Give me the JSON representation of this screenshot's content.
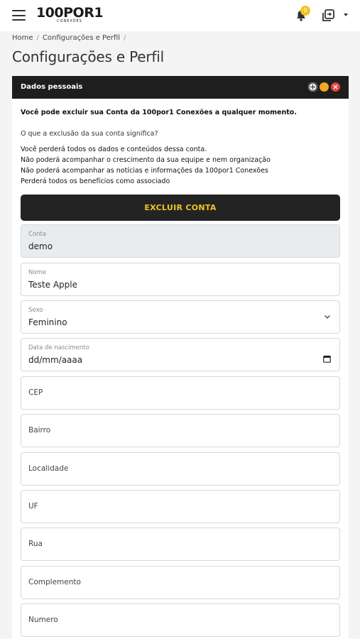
{
  "header": {
    "logo_main": "100POR1",
    "logo_sub": "CONEXÕES",
    "notification_count": "0"
  },
  "breadcrumb": {
    "items": [
      "Home",
      "Configurações e Perfil"
    ]
  },
  "page_title": "Configurações e Perfil",
  "panel": {
    "title": "Dados pessoais",
    "warning": "Você pode excluir sua Conta da 100por1 Conexões a qualquer momento.",
    "question": "O que a exclusão da sua conta significa?",
    "consequences": [
      "Você perderá todos os dados e conteúdos dessa conta.",
      "Não poderá acompanhar o crescimento da sua equipe e nem organização",
      "Não poderá acompanhar as notícias e informações da 100por1 Conexões",
      "Perderá todos os benefícios como associado"
    ],
    "delete_button": "EXCLUIR CONTA"
  },
  "form": {
    "conta": {
      "label": "Conta",
      "value": "demo"
    },
    "nome": {
      "label": "Nome",
      "value": "Teste Apple"
    },
    "sexo": {
      "label": "Sexo",
      "value": "Feminino"
    },
    "nascimento": {
      "label": "Data de nascimento",
      "value": "dd/mm/aaaa"
    },
    "cep": {
      "placeholder": "CEP"
    },
    "bairro": {
      "placeholder": "Bairro"
    },
    "localidade": {
      "placeholder": "Localidade"
    },
    "uf": {
      "placeholder": "UF"
    },
    "rua": {
      "placeholder": "Rua"
    },
    "complemento": {
      "placeholder": "Complemento"
    },
    "numero": {
      "placeholder": "Numero"
    }
  },
  "colors": {
    "accent": "#f2c524",
    "dark": "#232323",
    "minimize": "#f5a623",
    "close": "#e8413c"
  },
  "icons": [
    "menu-icon",
    "bell-icon",
    "switch-account-icon",
    "caret-down-icon",
    "move-icon",
    "minimize-icon",
    "close-icon",
    "chevron-down-icon",
    "calendar-icon"
  ]
}
